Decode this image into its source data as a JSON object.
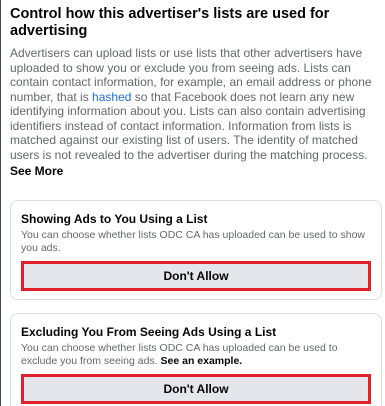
{
  "header": {
    "title": "Control how this advertiser's lists are used for advertising"
  },
  "description": {
    "part1": "Advertisers can upload lists or use lists that other advertisers have uploaded to show you or exclude you from seeing ads. Lists can contain contact information, for example, an email address or phone number, that is ",
    "link_label": "hashed",
    "part2": " so that Facebook does not learn any new identifying information about you. Lists can also contain advertising identifiers instead of contact information. Information from lists is matched against our existing list of users. The identity of matched users is not revealed to the advertiser during the matching process.",
    "see_more_label": "See More"
  },
  "cards": [
    {
      "title": "Showing Ads to You Using a List",
      "subtitle": "You can choose whether lists ODC CA has uploaded can be used to show you ads.",
      "button_label": "Don't Allow"
    },
    {
      "title": "Excluding You From Seeing Ads Using a List",
      "subtitle": "You can choose whether lists ODC CA has uploaded can be used to exclude you from seeing ads. ",
      "example_link_label": "See an example.",
      "button_label": "Don't Allow"
    }
  ],
  "colors": {
    "link": "#216fdb",
    "highlight_border": "#e0202a",
    "button_bg": "#e4e6eb"
  }
}
